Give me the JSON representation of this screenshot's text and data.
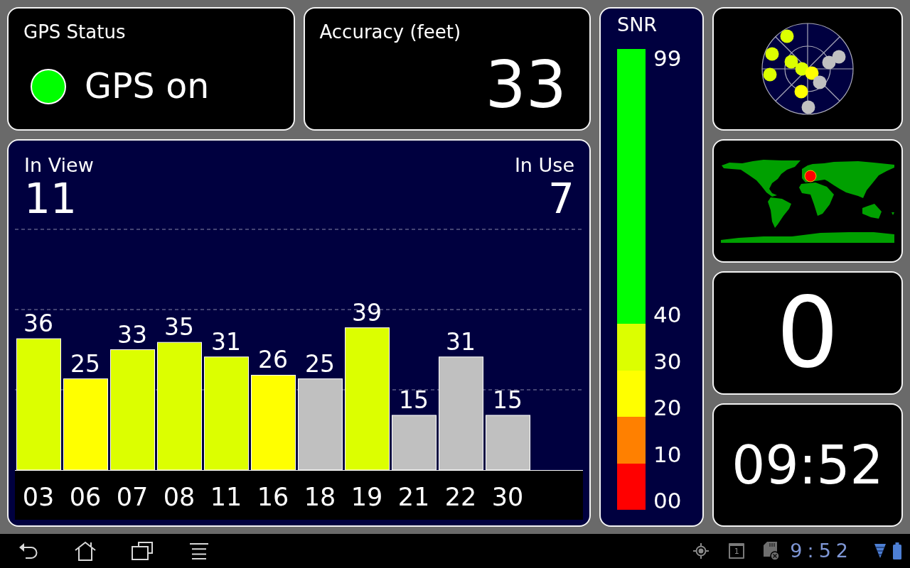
{
  "gps_status": {
    "title": "GPS Status",
    "on": true,
    "text": "GPS on"
  },
  "accuracy": {
    "title": "Accuracy (feet)",
    "value": "33"
  },
  "satellites": {
    "in_view": {
      "label": "In View",
      "value": "11"
    },
    "in_use": {
      "label": "In Use",
      "value": "7"
    },
    "chart_data": {
      "type": "bar",
      "categories": [
        "03",
        "06",
        "07",
        "08",
        "11",
        "16",
        "18",
        "19",
        "21",
        "22",
        "30"
      ],
      "values": [
        36,
        25,
        33,
        35,
        31,
        26,
        25,
        39,
        15,
        31,
        15
      ],
      "colors": [
        "#dcff00",
        "#ffff00",
        "#dcff00",
        "#dcff00",
        "#dcff00",
        "#ffff00",
        "#c0c0c0",
        "#dcff00",
        "#c0c0c0",
        "#c0c0c0",
        "#c0c0c0"
      ],
      "data_labels": true,
      "ref_lines": [
        {
          "axis": "y",
          "value": 22,
          "line_style": "dashed"
        },
        {
          "axis": "y",
          "value": 44,
          "line_style": "dashed"
        },
        {
          "axis": "y",
          "value": 66,
          "line_style": "dashed"
        }
      ]
    }
  },
  "snr": {
    "title": "SNR",
    "top_label": "99",
    "segments": [
      {
        "label": "40",
        "color": "#00ff00"
      },
      {
        "label": "30",
        "color": "#dcff00"
      },
      {
        "label": "20",
        "color": "#ffff00"
      },
      {
        "label": "10",
        "color": "#ff8000"
      },
      {
        "label": "00",
        "color": "#ff0000"
      }
    ]
  },
  "number_panel": {
    "value": "0"
  },
  "clock": {
    "time": "09:52"
  },
  "status_bar": {
    "calendar_day": "1",
    "time": "9:52"
  }
}
